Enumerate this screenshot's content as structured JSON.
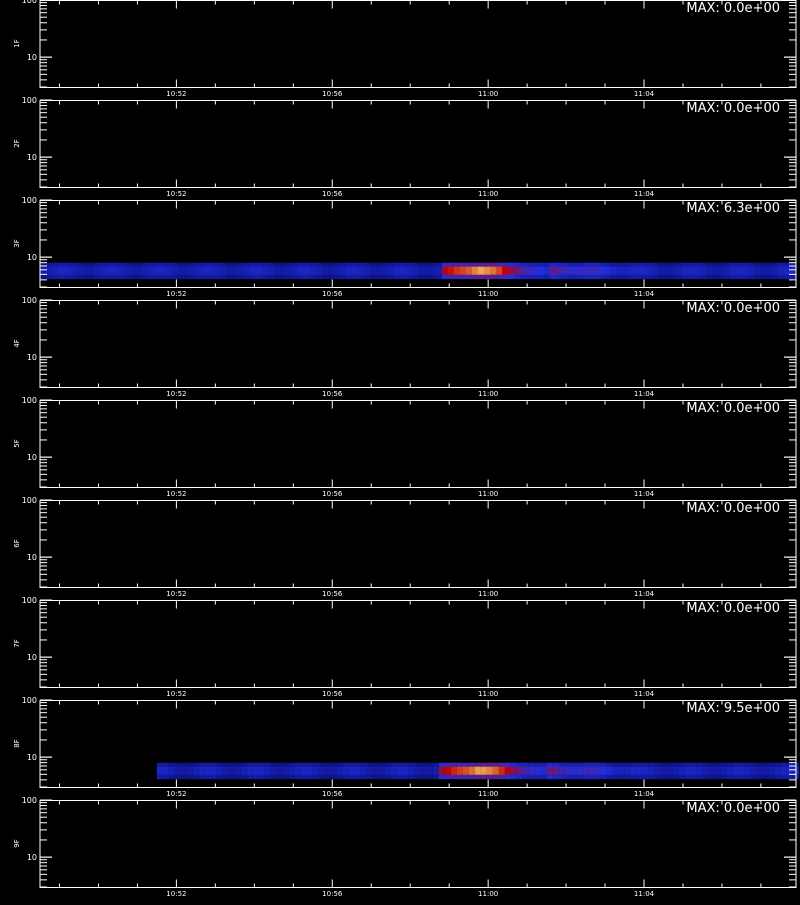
{
  "chart_data": {
    "type": "heatmap",
    "x_range": [
      "10:49",
      "11:08"
    ],
    "x_ticks": [
      "10:52",
      "10:56",
      "11:00",
      "11:04"
    ],
    "y_scale": "log",
    "y_range": [
      3,
      100
    ],
    "y_ticks": [
      "100",
      "10"
    ],
    "max_prefix": "MAX: ",
    "colors": {
      "background": "#000000",
      "axis": "#ffffff",
      "low": "#0a0a6e",
      "mid": "#1f2fe0",
      "high": "#c40000",
      "peak": "#ffff80"
    },
    "panels": [
      {
        "label": "1F",
        "max": "0.0e+00",
        "band": null
      },
      {
        "label": "2F",
        "max": "0.0e+00",
        "band": null
      },
      {
        "label": "3F",
        "max": "6.3e+00",
        "band": {
          "y_center": 5.5,
          "y_halfwidth": 1.5,
          "start": "10:49",
          "burst_start": "10:59",
          "peak": "11:00",
          "burst_end": "11:01",
          "end": "11:08"
        }
      },
      {
        "label": "4F",
        "max": "0.0e+00",
        "band": null
      },
      {
        "label": "5F",
        "max": "0.0e+00",
        "band": null
      },
      {
        "label": "6F",
        "max": "0.0e+00",
        "band": null
      },
      {
        "label": "7F",
        "max": "0.0e+00",
        "band": null
      },
      {
        "label": "8F",
        "max": "9.5e+00",
        "band": {
          "y_center": 5.5,
          "y_halfwidth": 1.5,
          "start": "10:52",
          "burst_start": "10:59",
          "peak": "11:00",
          "burst_end": "11:01",
          "end": "11:08"
        }
      },
      {
        "label": "9F",
        "max": "0.0e+00",
        "band": null
      }
    ]
  }
}
